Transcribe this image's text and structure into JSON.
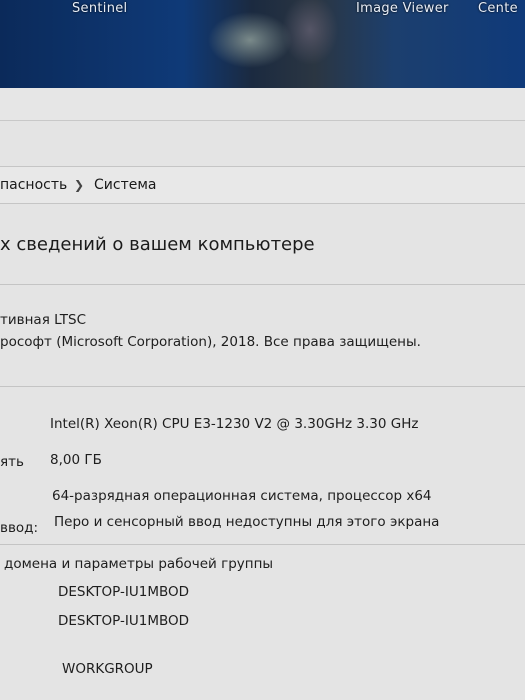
{
  "desktop": {
    "icon_left": "Sentinel",
    "icon_mid": "Image Viewer",
    "icon_right": "Cente"
  },
  "breadcrumb": {
    "parent": "пасность",
    "current": "Система"
  },
  "title": "х сведений о вашем компьютере",
  "edition": {
    "name": "тивная LTSC",
    "copyright": "рософт (Microsoft Corporation), 2018. Все права защищены."
  },
  "system": {
    "processor": "Intel(R) Xeon(R) CPU E3-1230 V2 @ 3.30GHz   3.30 GHz",
    "ram_label": "ять",
    "ram_value": "8,00 ГБ",
    "type_value": "64-разрядная операционная система, процессор x64",
    "pen_label": "ввод:",
    "pen_value": "Перо и сенсорный ввод недоступны для этого экрана"
  },
  "domain": {
    "heading": "домена и параметры рабочей группы",
    "computer_name": "DESKTOP-IU1MBOD",
    "full_name": "DESKTOP-IU1MBOD",
    "workgroup": "WORKGROUP"
  }
}
